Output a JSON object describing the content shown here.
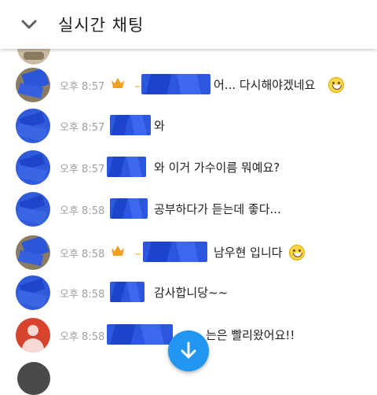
{
  "header": {
    "title": "실시간 채팅",
    "collapse_icon": "chevron-down-icon"
  },
  "messages": [
    {
      "time": "오후 8:57",
      "avatar": "photo",
      "crown": true,
      "text": "어... 다시해야겠네요",
      "emoji": "smile-emoji"
    },
    {
      "time": "오후 8:57",
      "avatar": "blue",
      "crown": false,
      "text": "와"
    },
    {
      "time": "오후 8:57",
      "avatar": "blue",
      "crown": false,
      "text": "와 이거 가수이름 뭐예요?"
    },
    {
      "time": "오후 8:58",
      "avatar": "blue",
      "crown": false,
      "text": "공부하다가 듣는데 좋다..."
    },
    {
      "time": "오후 8:58",
      "avatar": "photo",
      "crown": true,
      "text": "남우현 입니다",
      "emoji": "smile-emoji"
    },
    {
      "time": "오후 8:58",
      "avatar": "blue",
      "crown": false,
      "text": "감사합니당~~"
    },
    {
      "time": "오후 8:58",
      "avatar": "default",
      "crown": false,
      "text": "는은 빨리왔어요!!"
    }
  ],
  "scroll_button": {
    "icon": "arrow-down-icon"
  },
  "colors": {
    "accent": "#2196f3",
    "crown": "#f0a020",
    "time": "#9e9e9e"
  }
}
